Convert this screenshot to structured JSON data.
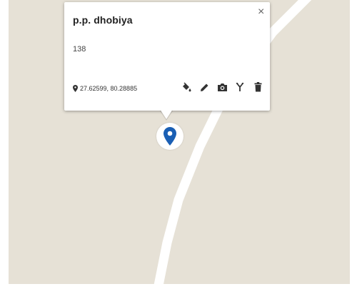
{
  "popup": {
    "title": "p.p. dhobiya",
    "value": "138",
    "coordinates": "27.62599, 80.28885",
    "close_symbol": "×"
  },
  "icons": {
    "coordinates_pin": "location-pin-icon",
    "tools": [
      "paint-bucket-icon",
      "pencil-icon",
      "camera-icon",
      "route-fork-icon",
      "trash-icon"
    ],
    "marker": "map-marker-icon"
  },
  "colors": {
    "map_background": "#e6e1d6",
    "road": "#ffffff",
    "marker": "#1a5fb4",
    "icon_dark": "#333333"
  }
}
